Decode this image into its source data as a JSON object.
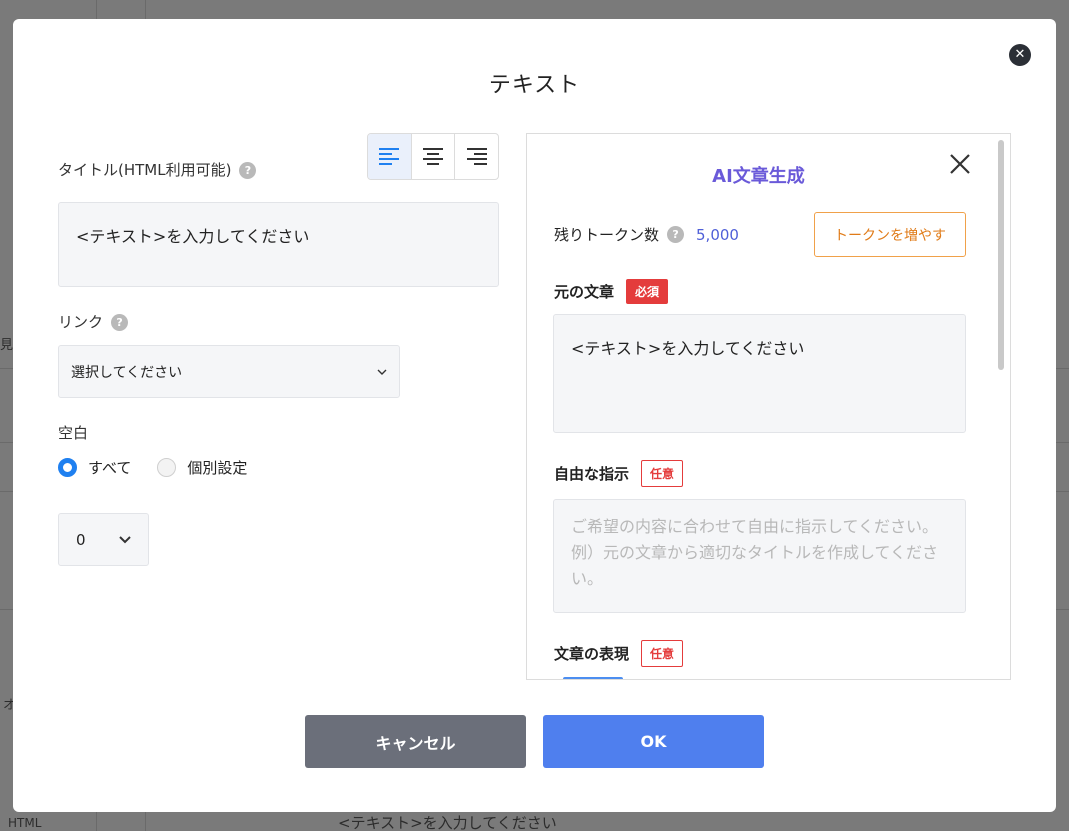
{
  "background": {
    "side_texts": [
      "見",
      "オ",
      "HTML"
    ],
    "bottom_text": "<テキスト>を入力してください"
  },
  "dialog": {
    "title": "テキスト",
    "close_icon": "close-icon"
  },
  "form": {
    "title_label": "タイトル(HTML利用可能)",
    "title_help": "?",
    "align_buttons": [
      {
        "icon": "align-left-icon",
        "active": true
      },
      {
        "icon": "align-center-icon",
        "active": false
      },
      {
        "icon": "align-right-icon",
        "active": false
      }
    ],
    "title_value": "<テキスト>を入力してください",
    "link_label": "リンク",
    "link_help": "?",
    "link_select_value": "選択してください",
    "space_label": "空白",
    "space_options": [
      {
        "label": "すべて",
        "selected": true
      },
      {
        "label": "個別設定",
        "selected": false
      }
    ],
    "space_value": "0"
  },
  "ai": {
    "title": "AI文章生成",
    "tokens_label": "残りトークン数",
    "tokens_help": "?",
    "tokens_value": "5,000",
    "add_tokens_button": "トークンを増やす",
    "source_label": "元の文章",
    "required_badge": "必須",
    "source_value": "<テキスト>を入力してください",
    "instruction_label": "自由な指示",
    "optional_badge": "任意",
    "instruction_placeholder": "ご希望の内容に合わせて自由に指示してください。例）元の文章から適切なタイトルを作成してください。",
    "expression_label": "文章の表現",
    "expression_badge": "任意"
  },
  "footer": {
    "cancel_label": "キャンセル",
    "ok_label": "OK"
  },
  "colors": {
    "accent_blue": "#4f7fee",
    "ai_title": "#6a5ad9",
    "required_red": "#e43c3c",
    "orange": "#e07b18"
  }
}
